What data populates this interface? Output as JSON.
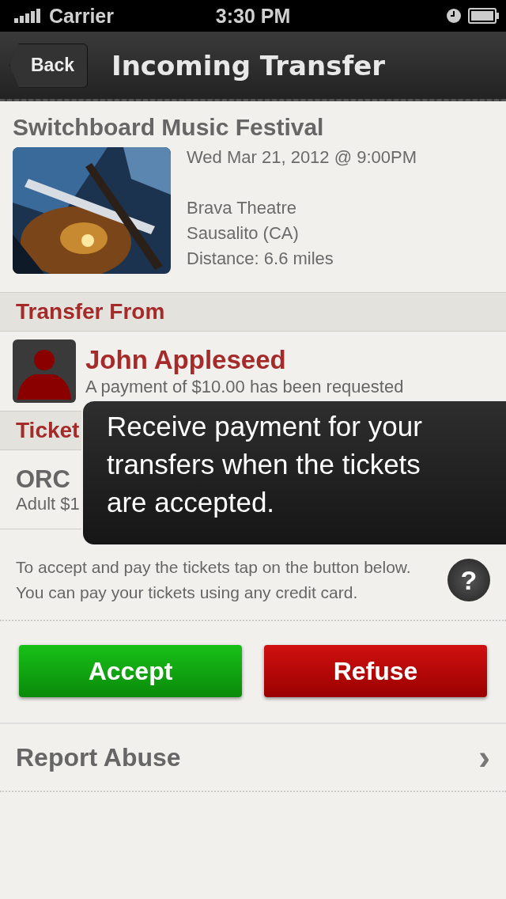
{
  "status_bar": {
    "carrier": "Carrier",
    "time": "3:30 PM"
  },
  "nav": {
    "back": "Back",
    "title": "Incoming Transfer"
  },
  "event": {
    "title": "Switchboard Music Festival",
    "kind": "picture",
    "date": "Wed Mar 21, 2012 @ 9:00PM",
    "venue": "Brava Theatre",
    "city": "Sausalito (CA)",
    "distance": "Distance: 6.6 miles"
  },
  "transfer_header": "Transfer From",
  "sender": {
    "name": "John Appleseed",
    "note": "A payment of $10.00 has been requested"
  },
  "tickets_header": "Ticket",
  "ticket": {
    "seat": "ORC",
    "price": "Adult $1"
  },
  "instructions": "To accept and pay the tickets tap on the button below. You can pay your tickets using any credit card.",
  "help": "?",
  "buttons": [
    {
      "label": "Accept",
      "kind": "accept"
    },
    {
      "label": "Refuse",
      "kind": "refuse"
    }
  ],
  "report": {
    "label": "Report Abuse",
    "chevron": "›"
  },
  "tooltip": "Receive payment for your transfers when the tickets are accepted."
}
